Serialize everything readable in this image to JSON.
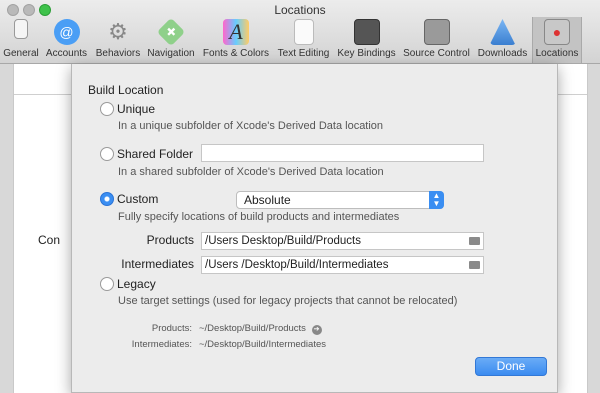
{
  "window": {
    "title": "Locations"
  },
  "toolbar": [
    {
      "label": "General",
      "icon": "general-icon"
    },
    {
      "label": "Accounts",
      "icon": "accounts-icon"
    },
    {
      "label": "Behaviors",
      "icon": "behaviors-icon"
    },
    {
      "label": "Navigation",
      "icon": "navigation-icon"
    },
    {
      "label": "Fonts & Colors",
      "icon": "fonts-colors-icon"
    },
    {
      "label": "Text Editing",
      "icon": "text-editing-icon"
    },
    {
      "label": "Key Bindings",
      "icon": "key-bindings-icon"
    },
    {
      "label": "Source Control",
      "icon": "source-control-icon"
    },
    {
      "label": "Downloads",
      "icon": "downloads-icon"
    },
    {
      "label": "Locations",
      "icon": "locations-icon",
      "selected": true
    }
  ],
  "background": {
    "partial_label": "Con"
  },
  "sheet": {
    "title": "Build Location",
    "options": {
      "unique": {
        "label": "Unique",
        "desc": "In a unique subfolder of Xcode's Derived Data location",
        "checked": false
      },
      "shared": {
        "label": "Shared Folder",
        "desc": "In a shared subfolder of Xcode's Derived Data location",
        "value": "",
        "checked": false
      },
      "custom": {
        "label": "Custom",
        "select_value": "Absolute",
        "desc": "Fully specify locations of build products and intermediates",
        "checked": true
      },
      "legacy": {
        "label": "Legacy",
        "desc": "Use target settings (used for legacy projects that cannot be relocated)",
        "checked": false
      }
    },
    "paths": {
      "products_label": "Products",
      "products_value": "/Users            Desktop/Build/Products",
      "intermediates_label": "Intermediates",
      "intermediates_value": "/Users             /Desktop/Build/Intermediates"
    },
    "summary": {
      "products_key": "Products:",
      "products_val": "~/Desktop/Build/Products",
      "intermediates_key": "Intermediates:",
      "intermediates_val": "~/Desktop/Build/Intermediates"
    },
    "done_label": "Done"
  },
  "colors": {
    "accent": "#3a8ef2",
    "zoom": "#3fc24b"
  }
}
